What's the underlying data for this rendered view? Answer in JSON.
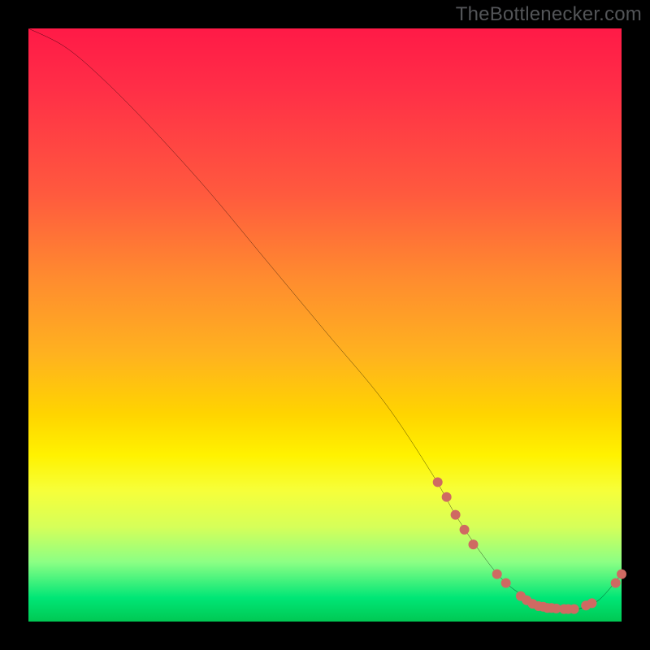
{
  "attribution": "TheBottlenecker.com",
  "chart_data": {
    "type": "line",
    "title": "",
    "xlabel": "",
    "ylabel": "",
    "xlim": [
      0,
      100
    ],
    "ylim": [
      0,
      100
    ],
    "series": [
      {
        "name": "bottleneck-curve",
        "color": "#000000",
        "x": [
          0,
          6,
          12,
          20,
          30,
          40,
          50,
          60,
          68,
          72,
          76,
          80,
          84,
          88,
          92,
          96,
          100
        ],
        "y": [
          100,
          97,
          92,
          84,
          73,
          61,
          49,
          37,
          25,
          18,
          12,
          7,
          4,
          2.2,
          2,
          3.5,
          8
        ]
      }
    ],
    "markers": {
      "name": "highlight-dots",
      "color": "#cf6a62",
      "radius": 6,
      "points": [
        {
          "x": 69,
          "y": 23.5
        },
        {
          "x": 70.5,
          "y": 21
        },
        {
          "x": 72,
          "y": 18
        },
        {
          "x": 73.5,
          "y": 15.5
        },
        {
          "x": 75,
          "y": 13
        },
        {
          "x": 79,
          "y": 8
        },
        {
          "x": 80.5,
          "y": 6.5
        },
        {
          "x": 83,
          "y": 4.3
        },
        {
          "x": 84,
          "y": 3.6
        },
        {
          "x": 85,
          "y": 3
        },
        {
          "x": 86,
          "y": 2.6
        },
        {
          "x": 86.8,
          "y": 2.5
        },
        {
          "x": 87.5,
          "y": 2.3
        },
        {
          "x": 88.2,
          "y": 2.3
        },
        {
          "x": 89,
          "y": 2.2
        },
        {
          "x": 90.3,
          "y": 2.1
        },
        {
          "x": 91,
          "y": 2.1
        },
        {
          "x": 92,
          "y": 2.1
        },
        {
          "x": 94,
          "y": 2.7
        },
        {
          "x": 95,
          "y": 3.1
        },
        {
          "x": 99,
          "y": 6.5
        },
        {
          "x": 100,
          "y": 8
        }
      ]
    }
  }
}
